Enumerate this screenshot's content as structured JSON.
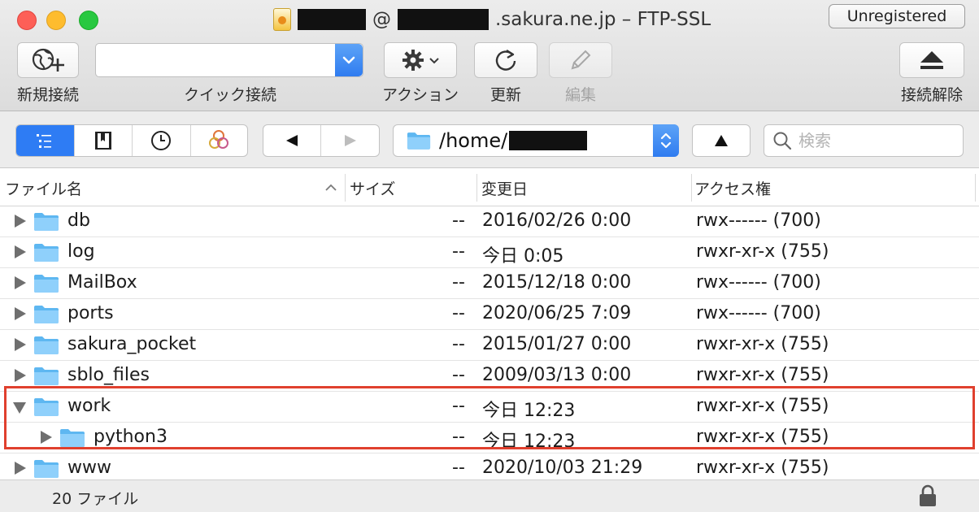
{
  "window": {
    "title_suffix_1": "@",
    "title_suffix_2": ".sakura.ne.jp – FTP-SSL",
    "unregistered_label": "Unregistered"
  },
  "toolbar": {
    "new_connection_label": "新規接続",
    "quick_connect_label": "クイック接続",
    "quick_connect_value": "",
    "action_label": "アクション",
    "refresh_label": "更新",
    "edit_label": "編集",
    "disconnect_label": "接続解除"
  },
  "navbar": {
    "path_prefix": "/home/",
    "search_placeholder": "検索"
  },
  "table": {
    "columns": {
      "name": "ファイル名",
      "size": "サイズ",
      "modified": "変更日",
      "access": "アクセス権"
    },
    "rows": [
      {
        "name": "db",
        "size": "--",
        "modified": "2016/02/26 0:00",
        "access": "rwx------ (700)"
      },
      {
        "name": "log",
        "size": "--",
        "modified": "今日 0:05",
        "access": "rwxr-xr-x (755)"
      },
      {
        "name": "MailBox",
        "size": "--",
        "modified": "2015/12/18 0:00",
        "access": "rwx------ (700)"
      },
      {
        "name": "ports",
        "size": "--",
        "modified": "2020/06/25 7:09",
        "access": "rwx------ (700)"
      },
      {
        "name": "sakura_pocket",
        "size": "--",
        "modified": "2015/01/27 0:00",
        "access": "rwxr-xr-x (755)"
      },
      {
        "name": "sblo_files",
        "size": "--",
        "modified": "2009/03/13 0:00",
        "access": "rwxr-xr-x (755)"
      },
      {
        "name": "work",
        "size": "--",
        "modified": "今日 12:23",
        "access": "rwxr-xr-x (755)",
        "expanded": true
      },
      {
        "name": "python3",
        "size": "--",
        "modified": "今日 12:23",
        "access": "rwxr-xr-x (755)",
        "child": true
      },
      {
        "name": "www",
        "size": "--",
        "modified": "2020/10/03 21:29",
        "access": "rwxr-xr-x (755)"
      }
    ]
  },
  "status": {
    "file_count": "20 ファイル"
  },
  "colors": {
    "accent": "#2e7cf4",
    "highlight_border": "#e0402e",
    "folder": "#5eb7f1"
  }
}
